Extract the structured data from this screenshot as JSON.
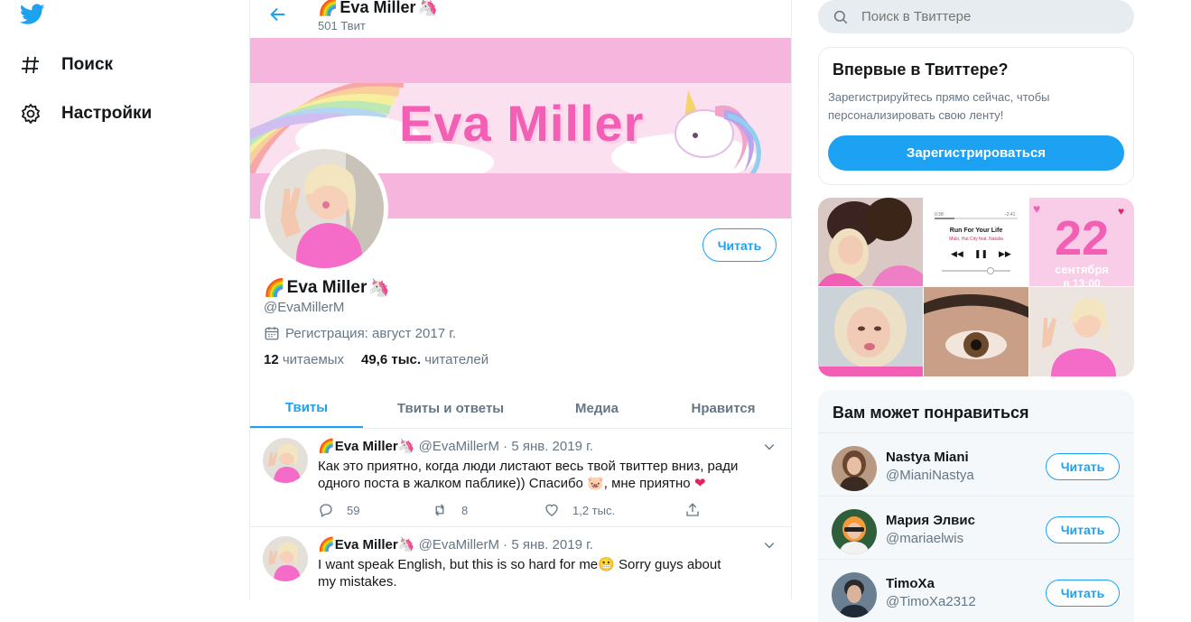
{
  "nav": {
    "search_label": "Поиск",
    "settings_label": "Настройки"
  },
  "header": {
    "name": "Eva Miller",
    "tweet_count": "501 Твит"
  },
  "banner": {
    "text": "Eva Miller"
  },
  "profile": {
    "follow_label": "Читать",
    "name": "Eva Miller",
    "handle": "@EvaMillerM",
    "joined": "Регистрация: август 2017 г.",
    "following_count": "12",
    "following_label": "читаемых",
    "followers_count": "49,6 тыс.",
    "followers_label": "читателей"
  },
  "tabs": [
    {
      "label": "Твиты",
      "active": true
    },
    {
      "label": "Твиты и ответы",
      "active": false
    },
    {
      "label": "Медиа",
      "active": false
    },
    {
      "label": "Нравится",
      "active": false
    }
  ],
  "tweets": [
    {
      "name": "Eva Miller",
      "handle": "@EvaMillerM",
      "date": "· 5 янв. 2019 г.",
      "text": "Как это приятно, когда люди листают весь твой твиттер вниз, ради одного поста в жалком паблике)) Спасибо 🐷, мне приятно",
      "replies": "59",
      "retweets": "8",
      "likes": "1,2 тыс."
    },
    {
      "name": "Eva Miller",
      "handle": "@EvaMillerM",
      "date": "· 5 янв. 2019 г.",
      "text": "I want speak English, but this is so hard for me😬 Sorry guys about my mistakes."
    }
  ],
  "search": {
    "placeholder": "Поиск в Твиттере"
  },
  "signup": {
    "title": "Впервые в Твиттере?",
    "description": "Зарегистрируйтесь прямо сейчас, чтобы персонализировать свою ленту!",
    "button_label": "Зарегистрироваться"
  },
  "media": {
    "music_title": "Run For Your Life",
    "music_artist": "Malo, Hut City feat. Natalia",
    "time_left": "0:38",
    "time_right": "-2:41",
    "date_number": "22",
    "date_month": "сентября",
    "date_time": "в 13:00"
  },
  "suggestions": {
    "title": "Вам может понравиться",
    "follow_label": "Читать",
    "items": [
      {
        "name": "Nastya Miani",
        "handle": "@MianiNastya"
      },
      {
        "name": "Мария Элвис",
        "handle": "@mariaelwis"
      },
      {
        "name": "TimoXa",
        "handle": "@TimoXa2312"
      }
    ]
  },
  "colors": {
    "accent": "#1da1f2",
    "banner_pink": "#f6bbe0",
    "like_red": "#e0245e"
  }
}
